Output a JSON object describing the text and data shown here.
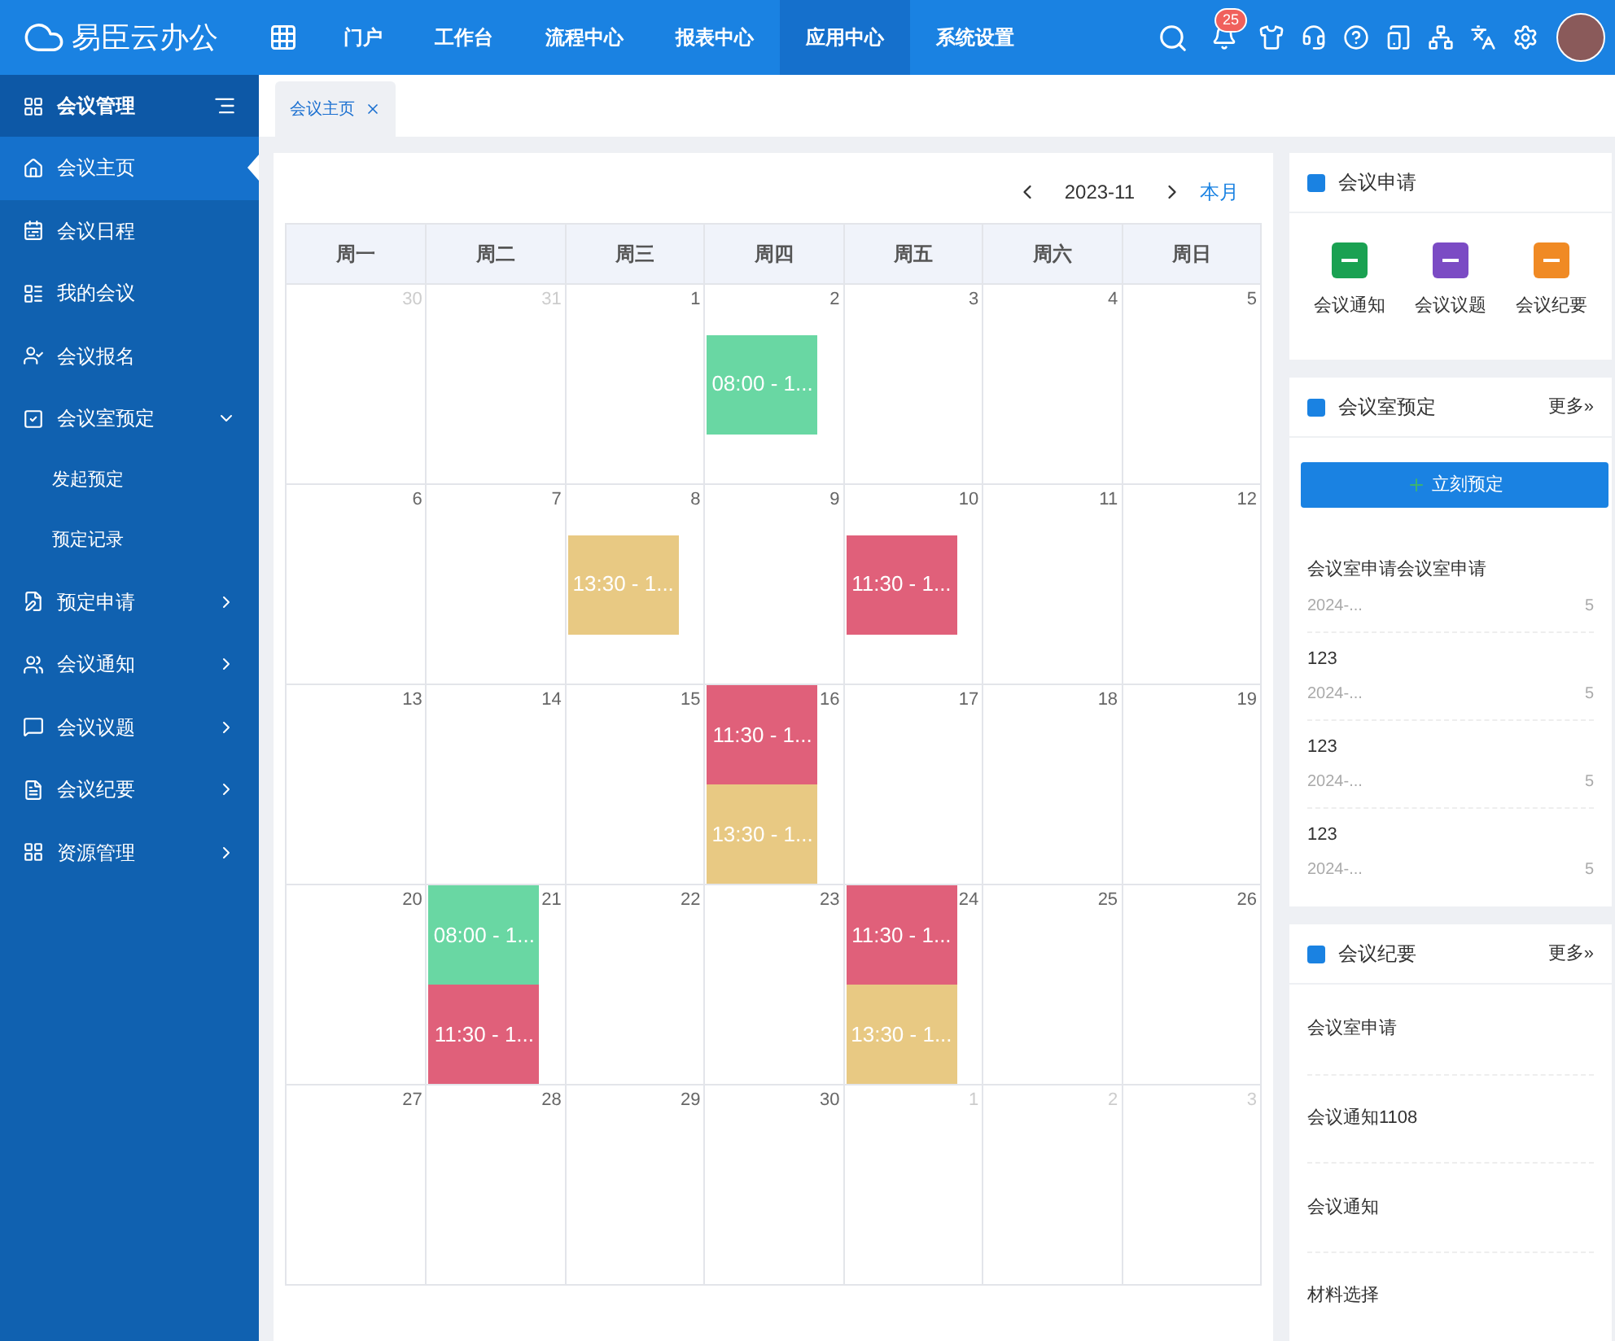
{
  "brand": {
    "name": "易臣云办公"
  },
  "nav": [
    {
      "label": "门户",
      "selected": false
    },
    {
      "label": "工作台",
      "selected": false
    },
    {
      "label": "流程中心",
      "selected": false
    },
    {
      "label": "报表中心",
      "selected": false
    },
    {
      "label": "应用中心",
      "selected": true
    },
    {
      "label": "系统设置",
      "selected": false
    }
  ],
  "notifications": {
    "count": "25"
  },
  "sidebar": {
    "title": "会议管理",
    "items": [
      {
        "label": "会议主页",
        "selected": true
      },
      {
        "label": "会议日程",
        "selected": false
      },
      {
        "label": "我的会议",
        "selected": false
      },
      {
        "label": "会议报名",
        "selected": false
      },
      {
        "label": "会议室预定",
        "selected": false,
        "expanded": true,
        "children": [
          {
            "label": "发起预定",
            "selected": false
          },
          {
            "label": "预定记录",
            "selected": false
          }
        ]
      },
      {
        "label": "预定申请",
        "selected": false,
        "expanded": false
      },
      {
        "label": "会议通知",
        "selected": false,
        "expanded": false
      },
      {
        "label": "会议议题",
        "selected": false,
        "expanded": false
      },
      {
        "label": "会议纪要",
        "selected": false,
        "expanded": false
      },
      {
        "label": "资源管理",
        "selected": false,
        "expanded": false
      }
    ]
  },
  "tabs": [
    {
      "label": "会议主页",
      "selected": true
    }
  ],
  "calendar": {
    "month": "2023-11",
    "today_button": "本月",
    "weekdays": [
      "周一",
      "周二",
      "周三",
      "周四",
      "周五",
      "周六",
      "周日"
    ],
    "days": [
      {
        "day": "30",
        "muted": true
      },
      {
        "day": "31",
        "muted": true
      },
      {
        "day": "1",
        "muted": false
      },
      {
        "day": "2",
        "muted": false,
        "events": [
          {
            "label": "08:00 - 1...",
            "color": "#69d7a3"
          }
        ]
      },
      {
        "day": "3",
        "muted": false
      },
      {
        "day": "4",
        "muted": false
      },
      {
        "day": "5",
        "muted": false
      },
      {
        "day": "6",
        "muted": false
      },
      {
        "day": "7",
        "muted": false
      },
      {
        "day": "8",
        "muted": false,
        "events": [
          {
            "label": "13:30 - 1...",
            "color": "#e8c983"
          }
        ]
      },
      {
        "day": "9",
        "muted": false
      },
      {
        "day": "10",
        "muted": false,
        "events": [
          {
            "label": "11:30 - 1...",
            "color": "#e0607a"
          }
        ]
      },
      {
        "day": "11",
        "muted": false
      },
      {
        "day": "12",
        "muted": false
      },
      {
        "day": "13",
        "muted": false
      },
      {
        "day": "14",
        "muted": false
      },
      {
        "day": "15",
        "muted": false
      },
      {
        "day": "16",
        "muted": false,
        "events": [
          {
            "label": "11:30 - 1...",
            "color": "#e0607a"
          },
          {
            "label": "13:30 - 1...",
            "color": "#e8c983"
          }
        ]
      },
      {
        "day": "17",
        "muted": false
      },
      {
        "day": "18",
        "muted": false
      },
      {
        "day": "19",
        "muted": false
      },
      {
        "day": "20",
        "muted": false
      },
      {
        "day": "21",
        "muted": false,
        "events": [
          {
            "label": "08:00 - 1...",
            "color": "#69d7a3"
          },
          {
            "label": "11:30 - 1...",
            "color": "#e0607a"
          }
        ]
      },
      {
        "day": "22",
        "muted": false
      },
      {
        "day": "23",
        "muted": false
      },
      {
        "day": "24",
        "muted": false,
        "events": [
          {
            "label": "11:30 - 1...",
            "color": "#e0607a"
          },
          {
            "label": "13:30 - 1...",
            "color": "#e8c983"
          }
        ]
      },
      {
        "day": "25",
        "muted": false
      },
      {
        "day": "26",
        "muted": false
      },
      {
        "day": "27",
        "muted": false
      },
      {
        "day": "28",
        "muted": false
      },
      {
        "day": "29",
        "muted": false
      },
      {
        "day": "30",
        "muted": false
      },
      {
        "day": "1",
        "muted": true
      },
      {
        "day": "2",
        "muted": true
      },
      {
        "day": "3",
        "muted": true
      }
    ]
  },
  "apply_card": {
    "title": "会议申请",
    "shortcuts": [
      {
        "label": "会议通知",
        "color": "#1aa152"
      },
      {
        "label": "会议议题",
        "color": "#7b4bc4"
      },
      {
        "label": "会议纪要",
        "color": "#f08a24"
      }
    ]
  },
  "booking_card": {
    "title": "会议室预定",
    "more": "更多»",
    "button": "立刻预定",
    "items": [
      {
        "title": "会议室申请会议室申请",
        "date": "2024-...",
        "count": "5"
      },
      {
        "title": "123",
        "date": "2024-...",
        "count": "5"
      },
      {
        "title": "123",
        "date": "2024-...",
        "count": "5"
      },
      {
        "title": "123",
        "date": "2024-...",
        "count": "5"
      }
    ]
  },
  "minutes_card": {
    "title": "会议纪要",
    "more": "更多»",
    "items": [
      "会议室申请",
      "会议通知1108",
      "会议通知",
      "材料选择"
    ]
  }
}
